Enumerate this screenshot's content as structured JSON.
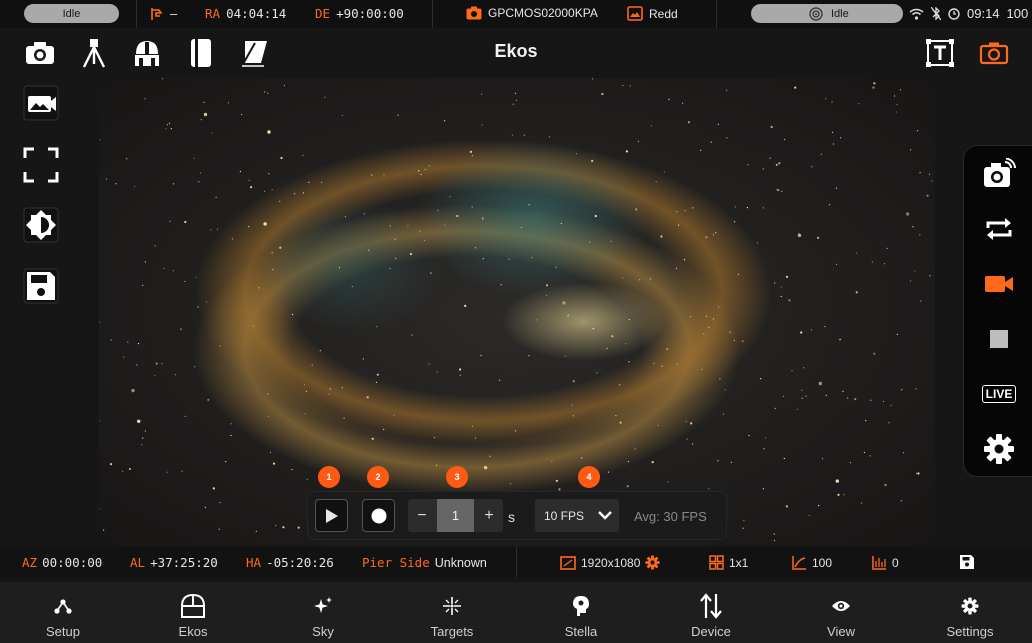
{
  "status_bar": {
    "left_status": "Idle",
    "mount_status": "–",
    "ra_label": "RA",
    "ra_value": "04:04:14",
    "de_label": "DE",
    "de_value": "+90:00:00",
    "camera_name": "GPCMOS02000KPA",
    "image_label": "Redd",
    "right_status": "Idle",
    "time": "09:14",
    "battery": "100"
  },
  "toolbar": {
    "title": "Ekos"
  },
  "capture": {
    "badges": [
      "1",
      "2",
      "3",
      "4"
    ],
    "exposure_minus": "−",
    "exposure_value": "1",
    "exposure_plus": "+",
    "exposure_unit": "s",
    "fps_selected": "10 FPS",
    "avg_fps": "Avg: 30  FPS"
  },
  "right_panel": {
    "live_label": "LIVE"
  },
  "info_bar": {
    "az_label": "AZ",
    "az_value": "00:00:00",
    "al_label": "AL",
    "al_value": "+37:25:20",
    "ha_label": "HA",
    "ha_value": "-05:20:26",
    "pier_label": "Pier Side",
    "pier_value": "Unknown",
    "resolution": "1920x1080",
    "binning": "1x1",
    "gain": "100",
    "offset": "0"
  },
  "bottom_nav": {
    "items": [
      {
        "label": "Setup",
        "icon": "setup-icon"
      },
      {
        "label": "Ekos",
        "icon": "ekos-dome-icon"
      },
      {
        "label": "Sky",
        "icon": "sparkle-icon"
      },
      {
        "label": "Targets",
        "icon": "targets-icon"
      },
      {
        "label": "Stella",
        "icon": "stella-icon"
      },
      {
        "label": "Device",
        "icon": "device-arrows-icon"
      },
      {
        "label": "View",
        "icon": "eye-icon"
      },
      {
        "label": "Settings",
        "icon": "settings-gear-icon"
      }
    ]
  },
  "colors": {
    "accent": "#ff6a1a",
    "background": "#161616",
    "text": "#e6e6e6"
  }
}
